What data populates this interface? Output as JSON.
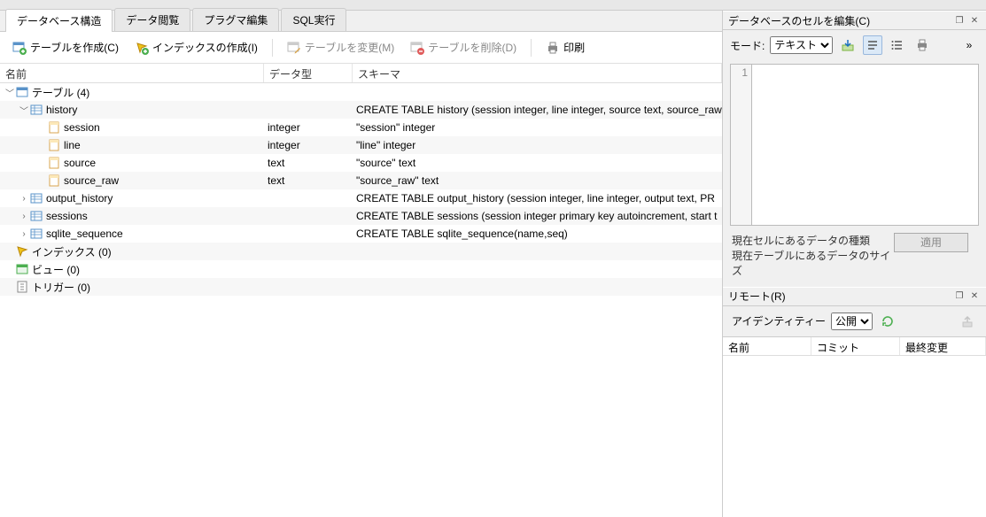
{
  "tabs": {
    "structure": "データベース構造",
    "browse": "データ閲覧",
    "pragma": "プラグマ編集",
    "sql": "SQL実行"
  },
  "toolbar": {
    "create_table": "テーブルを作成(C)",
    "create_index": "インデックスの作成(I)",
    "modify_table": "テーブルを変更(M)",
    "delete_table": "テーブルを削除(D)",
    "print": "印刷"
  },
  "tree_header": {
    "name": "名前",
    "type": "データ型",
    "schema": "スキーマ"
  },
  "tree": {
    "tables": {
      "label": "テーブル (4)"
    },
    "history": {
      "label": "history",
      "schema": "CREATE TABLE history (session integer, line integer, source text, source_raw",
      "cols": {
        "session": {
          "name": "session",
          "type": "integer",
          "schema": "\"session\" integer"
        },
        "line": {
          "name": "line",
          "type": "integer",
          "schema": "\"line\" integer"
        },
        "source": {
          "name": "source",
          "type": "text",
          "schema": "\"source\" text"
        },
        "source_raw": {
          "name": "source_raw",
          "type": "text",
          "schema": "\"source_raw\" text"
        }
      }
    },
    "output_history": {
      "label": "output_history",
      "schema": "CREATE TABLE output_history (session integer, line integer, output text, PR"
    },
    "sessions": {
      "label": "sessions",
      "schema": "CREATE TABLE sessions (session integer primary key autoincrement, start t"
    },
    "sqlite_sequence": {
      "label": "sqlite_sequence",
      "schema": "CREATE TABLE sqlite_sequence(name,seq)"
    },
    "indices": {
      "label": "インデックス (0)"
    },
    "views": {
      "label": "ビュー (0)"
    },
    "triggers": {
      "label": "トリガー (0)"
    }
  },
  "edit_panel": {
    "title": "データベースのセルを編集(C)",
    "mode_label": "モード:",
    "mode_value": "テキスト",
    "gutter_line": "1",
    "status_type": "現在セルにあるデータの種類",
    "status_size": "現在テーブルにあるデータのサイズ",
    "apply": "適用"
  },
  "remote_panel": {
    "title": "リモート(R)",
    "identity_label": "アイデンティティー",
    "identity_value": "公開",
    "head_name": "名前",
    "head_commit": "コミット",
    "head_modified": "最終変更"
  },
  "colors": {
    "accent": "#1a6fbf"
  }
}
